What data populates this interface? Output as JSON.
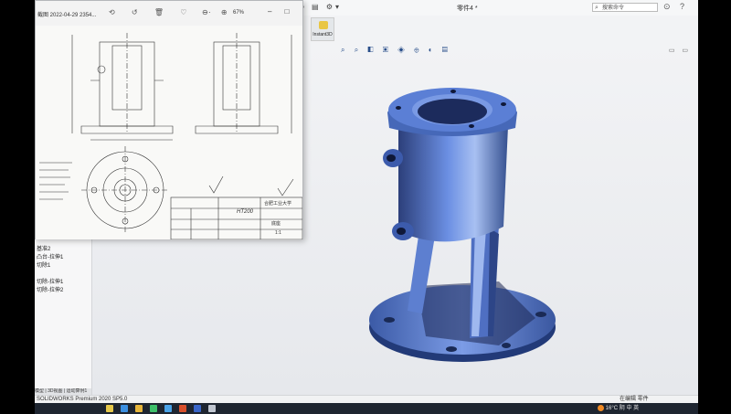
{
  "viewer": {
    "title": "截图 2022-04-29 2354...",
    "zoom": "67%",
    "tools": [
      "rotate-icon",
      "rotate-left-icon",
      "delete-icon",
      "heart-icon",
      "more-icon"
    ],
    "drawing": {
      "material": "HT200",
      "school": "合肥工业大学",
      "part": "底座",
      "scale": "1:1"
    }
  },
  "app": {
    "title": "零件4 *",
    "search_placeholder": "搜索命令",
    "tool_button_label": "Instant3D"
  },
  "feature_tree": {
    "items": [
      "基准2",
      "凸台-拉伸1",
      "切除1",
      "",
      "切除-拉伸1",
      "切除-拉伸2"
    ],
    "tabs": "模型 | 3D视图 | 运动算例1"
  },
  "status": {
    "left": "SOLIDWORKS Premium 2020 SP5.0",
    "right": "在编辑 零件"
  },
  "taskbar": {
    "weather": "16°C",
    "weather_text": "阴",
    "ime": "中",
    "lang": "英"
  },
  "colors": {
    "model": "#5a7fd6",
    "taskbar": "#1e2530"
  }
}
